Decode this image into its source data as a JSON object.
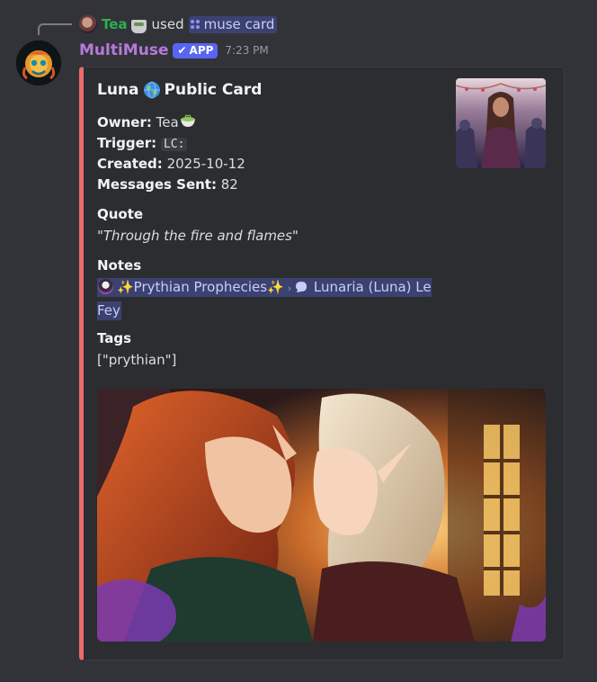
{
  "reply": {
    "username": "Tea",
    "emoji": "tea-cup-emoji",
    "action_text": "used",
    "command_label": "muse card"
  },
  "message": {
    "author": "MultiMuse",
    "badge_label": "APP",
    "timestamp": "7:23 PM"
  },
  "embed": {
    "accent_color": "#ec6a6a",
    "title_name": "Luna",
    "title_rest": "Public Card",
    "fields": {
      "owner_label": "Owner:",
      "owner_value": "Tea",
      "trigger_label": "Trigger:",
      "trigger_value": "LC:",
      "created_label": "Created:",
      "created_value": "2025-10-12",
      "messages_label": "Messages Sent:",
      "messages_value": "82"
    },
    "quote_title": "Quote",
    "quote_text": "\"Through the fire and flames\"",
    "notes_title": "Notes",
    "notes_channel": "✨Prythian Prophecies✨",
    "notes_thread": "Lunaria (Luna) Le Fey",
    "tags_title": "Tags",
    "tags_text": "[\"prythian\"]"
  }
}
